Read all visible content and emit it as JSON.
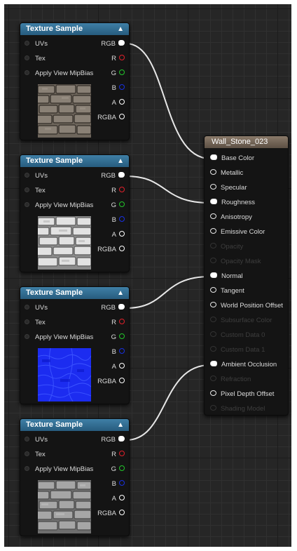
{
  "texture_nodes": [
    {
      "title": "Texture Sample",
      "inputs": [
        "UVs",
        "Tex",
        "Apply View MipBias"
      ],
      "outputs": [
        "RGB",
        "R",
        "G",
        "B",
        "A",
        "RGBA"
      ],
      "thumbnail": "stone wall color"
    },
    {
      "title": "Texture Sample",
      "inputs": [
        "UVs",
        "Tex",
        "Apply View MipBias"
      ],
      "outputs": [
        "RGB",
        "R",
        "G",
        "B",
        "A",
        "RGBA"
      ],
      "thumbnail": "stone wall roughness"
    },
    {
      "title": "Texture Sample",
      "inputs": [
        "UVs",
        "Tex",
        "Apply View MipBias"
      ],
      "outputs": [
        "RGB",
        "R",
        "G",
        "B",
        "A",
        "RGBA"
      ],
      "thumbnail": "stone wall normal"
    },
    {
      "title": "Texture Sample",
      "inputs": [
        "UVs",
        "Tex",
        "Apply View MipBias"
      ],
      "outputs": [
        "RGB",
        "R",
        "G",
        "B",
        "A",
        "RGBA"
      ],
      "thumbnail": "stone wall ambient occlusion"
    }
  ],
  "pin_colors": {
    "RGB": "#ffffff",
    "R": "#e0202a",
    "G": "#22c52a",
    "B": "#1830e0",
    "A": "#d8d8d8",
    "RGBA": "#ffffff"
  },
  "material": {
    "title": "Wall_Stone_023",
    "inputs": [
      {
        "label": "Base Color",
        "enabled": true,
        "connected": true
      },
      {
        "label": "Metallic",
        "enabled": true,
        "connected": false
      },
      {
        "label": "Specular",
        "enabled": true,
        "connected": false
      },
      {
        "label": "Roughness",
        "enabled": true,
        "connected": true
      },
      {
        "label": "Anisotropy",
        "enabled": true,
        "connected": false
      },
      {
        "label": "Emissive Color",
        "enabled": true,
        "connected": false
      },
      {
        "label": "Opacity",
        "enabled": false,
        "connected": false
      },
      {
        "label": "Opacity Mask",
        "enabled": false,
        "connected": false
      },
      {
        "label": "Normal",
        "enabled": true,
        "connected": true
      },
      {
        "label": "Tangent",
        "enabled": true,
        "connected": false
      },
      {
        "label": "World Position Offset",
        "enabled": true,
        "connected": false
      },
      {
        "label": "Subsurface Color",
        "enabled": false,
        "connected": false
      },
      {
        "label": "Custom Data 0",
        "enabled": false,
        "connected": false
      },
      {
        "label": "Custom Data 1",
        "enabled": false,
        "connected": false
      },
      {
        "label": "Ambient Occlusion",
        "enabled": true,
        "connected": true
      },
      {
        "label": "Refraction",
        "enabled": false,
        "connected": false
      },
      {
        "label": "Pixel Depth Offset",
        "enabled": true,
        "connected": false
      },
      {
        "label": "Shading Model",
        "enabled": false,
        "connected": false
      }
    ]
  },
  "colors": {
    "texture_header": "#3f7fa6",
    "material_header": "#8a7a6a",
    "graph_background": "#262626",
    "wire": "#e8e8e8"
  }
}
